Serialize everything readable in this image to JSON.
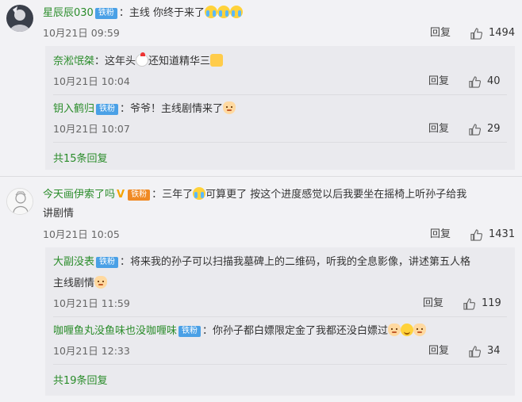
{
  "reply_label": "回复",
  "comments": [
    {
      "user": "星辰辰030",
      "badge": "铁粉",
      "text": "：主线 你终于来了",
      "time": "10月21日 09:59",
      "likes": "1494",
      "replies": [
        {
          "user": "奈淞氓桀",
          "text": "：这年头",
          "text2": "还知道精华三",
          "time": "10月21日 10:04",
          "likes": "40"
        },
        {
          "user": "钥入鹤归",
          "badge": "铁粉",
          "text": "：爷爷！主线剧情来了",
          "time": "10月21日 10:07",
          "likes": "29"
        }
      ],
      "more": "共15条回复"
    },
    {
      "user": "今天画伊索了吗",
      "badge": "铁粉",
      "text": "：三年了",
      "text2": "可算更了 按这个进度感觉以后我要坐在摇椅上听孙子给我",
      "text3": "讲剧情",
      "time": "10月21日 10:05",
      "likes": "1431",
      "replies": [
        {
          "user": "大副没表",
          "badge": "铁粉",
          "text": "：将来我的孙子可以扫描我墓碑上的二维码，听我的全息影像，讲述第五人格",
          "text2": "主线剧情",
          "time": "10月21日 11:59",
          "likes": "119"
        },
        {
          "user": "咖喱鱼丸没鱼味也没咖喱味",
          "badge": "铁粉",
          "text": "：你孙子都白嫖限定金了我都还没白嫖过",
          "time": "10月21日 12:33",
          "likes": "34"
        }
      ],
      "more": "共19条回复"
    }
  ]
}
